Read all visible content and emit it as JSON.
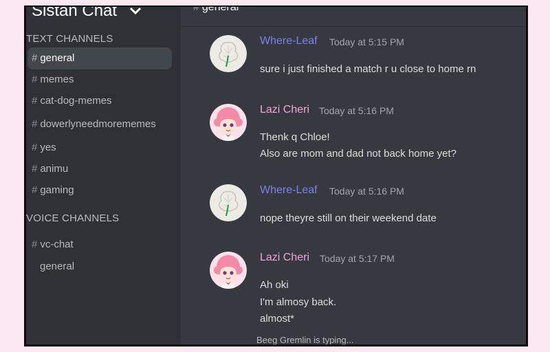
{
  "server": {
    "name": "Sistah Chat"
  },
  "header": {
    "channel": "general"
  },
  "sidebar": {
    "text_category": "TEXT CHANNELS",
    "text_channels": [
      "general",
      "memes",
      "cat-dog-memes",
      "dowerlyneedmorememes",
      "yes",
      "animu",
      "gaming"
    ],
    "voice_category": "VOICE CHANNELS",
    "voice_channels": [
      "vc-chat",
      "general"
    ]
  },
  "colors": {
    "where_leaf": "#7b83e6",
    "lazi_cheri": "#f2a6d6"
  },
  "messages": [
    {
      "author": "Where-Leaf",
      "time": "Today at 5:15 PM",
      "lines": [
        "sure i just finished a match r u close to home rn"
      ]
    },
    {
      "author": "Lazi Cheri",
      "time": "Today at 5:16 PM",
      "lines": [
        "Thenk q Chloe!",
        "Also are mom and dad not back home yet?"
      ]
    },
    {
      "author": "Where-Leaf",
      "time": "Today at 5:16 PM",
      "lines": [
        "nope theyre still on their weekend date"
      ]
    },
    {
      "author": "Lazi Cheri",
      "time": "Today at 5:17 PM",
      "lines": [
        "Ah oki",
        "I'm almosy back.",
        "almost*"
      ]
    }
  ],
  "typing": "Beeg Gremlin is typing..."
}
